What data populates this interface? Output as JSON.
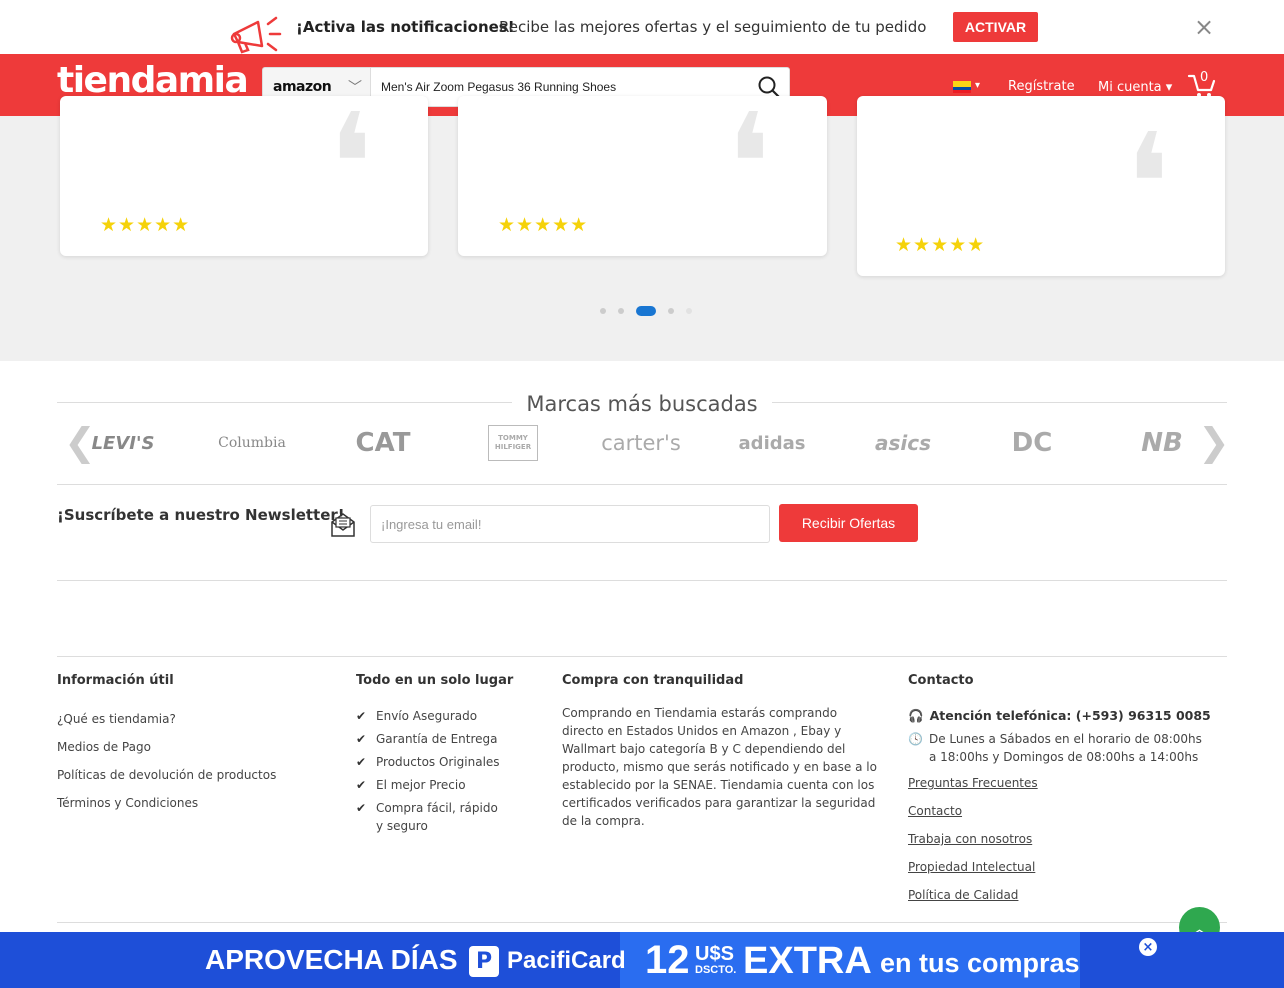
{
  "notification": {
    "title": "¡Activa las notificaciones!",
    "text": "Recibe las mejores ofertas y el seguimiento de tu pedido",
    "activate_label": "ACTIVAR",
    "close_label": "×"
  },
  "header": {
    "logo": "tiendamia",
    "store": "amazon",
    "search_value": "Men's Air Zoom Pegasus 36 Running Shoes",
    "register_label": "Regístrate",
    "account_label": "Mi cuenta",
    "cart_count": "0",
    "country": "Ecuador"
  },
  "testimonials": {
    "cards": [
      {
        "rating": 5
      },
      {
        "rating": 5
      },
      {
        "rating": 5
      }
    ],
    "stars": "★★★★★",
    "quote_mark": "❛",
    "active_dot": 2
  },
  "brands": {
    "title": "Marcas más buscadas",
    "items": [
      "LEVI'S",
      "Columbia",
      "CAT",
      "TOMMY HILFIGER",
      "carter's",
      "adidas",
      "asics",
      "DC",
      "NB"
    ]
  },
  "newsletter": {
    "title": "¡Suscríbete a nuestro Newsletter!",
    "placeholder": "¡Ingresa tu email!",
    "button_label": "Recibir Ofertas"
  },
  "footer": {
    "info": {
      "title": "Información útil",
      "links": [
        "¿Qué es tiendamia?",
        "Medios de Pago",
        "Políticas de devolución de productos",
        "Términos y Condiciones"
      ]
    },
    "all_in_one": {
      "title": "Todo en un solo lugar",
      "items": [
        "Envío Asegurado",
        "Garantía de Entrega",
        "Productos Originales",
        "El mejor Precio",
        "Compra fácil, rápido y seguro"
      ]
    },
    "calm": {
      "title": "Compra con tranquilidad",
      "text": "Comprando en Tiendamia estarás comprando directo en Estados Unidos en Amazon , Ebay y Wallmart bajo categoría B y C dependiendo del producto, mismo que serás notificado y en base a lo establecido por la SENAE. Tiendamia cuenta con los certificados verificados para garantizar la seguridad de la compra."
    },
    "contact": {
      "title": "Contacto",
      "phone": "Atención telefónica: (+593) 96315 0085",
      "hours": "De Lunes a Sábados en el horario de 08:00hs a 18:00hs y Domingos de 08:00hs a 14:00hs",
      "links": [
        "Preguntas Frecuentes",
        "Contacto",
        "Trabaja con nosotros",
        "Propiedad Intelectual",
        "Política de Calidad"
      ]
    }
  },
  "promo": {
    "text_a": "APROVECHA DÍAS",
    "logo_letter": "P",
    "brand": "PacifiCard",
    "number": "12",
    "currency": "U$S",
    "dscto": "DSCTO.",
    "extra": "EXTRA",
    "tail": "en tus compras",
    "close_label": "×"
  },
  "colors": {
    "brand_red": "#ee3a3a",
    "brand_purple": "#6b23c8",
    "promo_blue": "#1e4fd8",
    "star_yellow": "#f5d20a"
  }
}
